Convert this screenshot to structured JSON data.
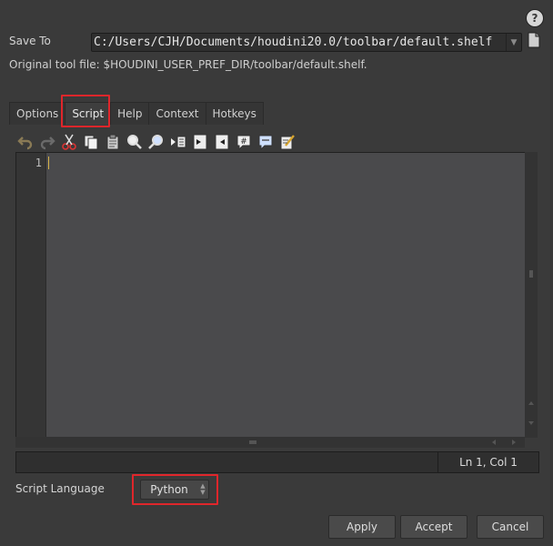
{
  "header": {
    "help_icon": "help-icon",
    "help_glyph": "?",
    "save_to_label": "Save To",
    "save_to_path": "C:/Users/CJH/Documents/houdini20.0/toolbar/default.shelf",
    "original_tool_file": "Original tool file: $HOUDINI_USER_PREF_DIR/toolbar/default.shelf."
  },
  "tabs": [
    {
      "label": "Options"
    },
    {
      "label": "Script"
    },
    {
      "label": "Help"
    },
    {
      "label": "Context"
    },
    {
      "label": "Hotkeys"
    }
  ],
  "active_tab": "Script",
  "toolbar_icons": [
    "undo-icon",
    "redo-icon",
    "cut-icon",
    "copy-icon",
    "paste-icon",
    "find-icon",
    "replace-icon",
    "indent-icon",
    "script-in-icon",
    "script-out-icon",
    "comment-icon",
    "uncomment-icon",
    "edit-icon"
  ],
  "editor": {
    "line_numbers": [
      "1"
    ],
    "content": ""
  },
  "status": {
    "position": "Ln 1, Col 1"
  },
  "script_language": {
    "label": "Script Language",
    "value": "Python"
  },
  "buttons": {
    "apply": "Apply",
    "accept": "Accept",
    "cancel": "Cancel"
  },
  "colors": {
    "highlight": "#e0262b",
    "caret": "#d8b44a"
  }
}
